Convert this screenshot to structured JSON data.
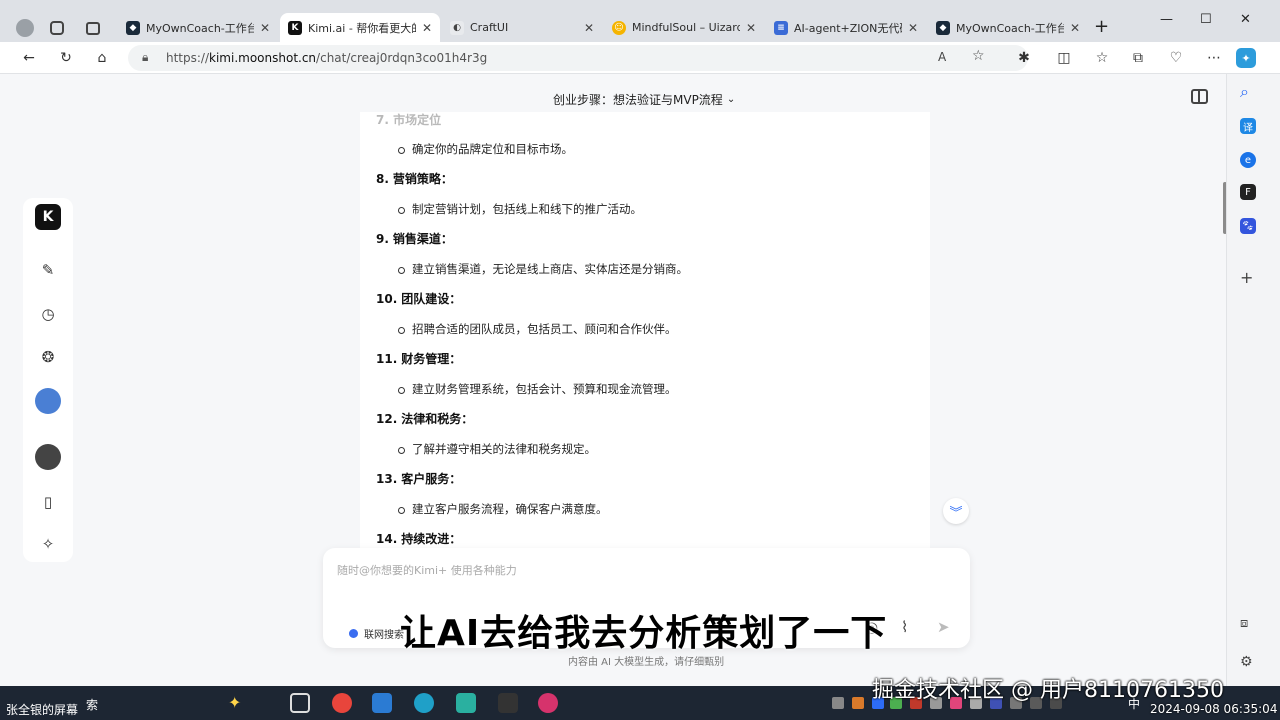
{
  "browser": {
    "tabs": [
      {
        "title": "MyOwnCoach-工作台",
        "active": false,
        "icon": "coach-icon"
      },
      {
        "title": "Kimi.ai - 帮你看更大的世界",
        "active": true,
        "icon": "kimi-icon"
      },
      {
        "title": "CraftUI",
        "active": false,
        "icon": "craftui-icon"
      },
      {
        "title": "MindfulSoul – Uizard",
        "active": false,
        "icon": "uizard-icon"
      },
      {
        "title": "AI-agent+ZION无代码开发",
        "active": false,
        "icon": "doc-icon"
      },
      {
        "title": "MyOwnCoach-工作台",
        "active": false,
        "icon": "coach-icon"
      }
    ],
    "new_tab": "+",
    "url_prefix": "https://",
    "url_host": "kimi.moonshot.cn",
    "url_path": "/chat/creaj0rdqn3co01h4r3g"
  },
  "chat": {
    "title": "创业步骤：想法验证与MVP流程",
    "faded_heading": "7. 市场定位",
    "items": [
      {
        "num": "",
        "title": "",
        "bullet": "确定你的品牌定位和目标市场。"
      },
      {
        "num": "8.",
        "title": "营销策略：",
        "bullet": "制定营销计划，包括线上和线下的推广活动。"
      },
      {
        "num": "9.",
        "title": "销售渠道：",
        "bullet": "建立销售渠道，无论是线上商店、实体店还是分销商。"
      },
      {
        "num": "10.",
        "title": "团队建设：",
        "bullet": "招聘合适的团队成员，包括员工、顾问和合作伙伴。"
      },
      {
        "num": "11.",
        "title": "财务管理：",
        "bullet": "建立财务管理系统，包括会计、预算和现金流管理。"
      },
      {
        "num": "12.",
        "title": "法律和税务：",
        "bullet": "了解并遵守相关的法律和税务规定。"
      },
      {
        "num": "13.",
        "title": "客户服务：",
        "bullet": "建立客户服务流程，确保客户满意度。"
      },
      {
        "num": "14.",
        "title": "持续改进：",
        "bullet": ""
      }
    ],
    "input_placeholder": "随时@你想要的Kimi+ 使用各种能力",
    "web_search_label": "联网搜索",
    "footnote": "内容由 AI 大模型生成，请仔细甄别"
  },
  "overlay": {
    "subtitle": "让AI去给我去分析策划了一下",
    "watermark": "掘金技术社区 @ 用户8110761350",
    "datetime": "2024-09-08 06:35:04"
  },
  "taskbar": {
    "left_label": "张全银的屏幕",
    "search_label": "索",
    "ime_label": "中"
  },
  "colors": {
    "accent": "#2d6cf6",
    "taskbar": "#1d2633"
  }
}
